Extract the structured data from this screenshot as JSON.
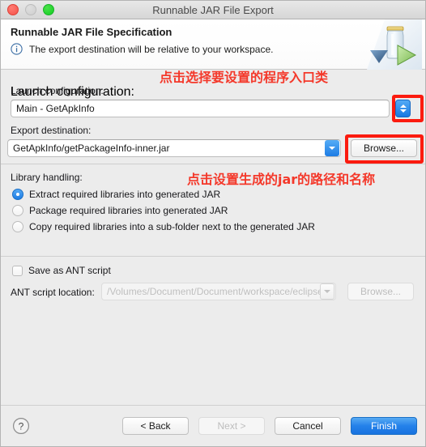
{
  "window": {
    "title": "Runnable JAR File Export",
    "traffic_lights": [
      "close-button",
      "minimize-button",
      "zoom-button"
    ]
  },
  "header": {
    "title": "Runnable JAR File Specification",
    "message": "The export destination will be relative to your workspace.",
    "info_icon": "info-icon",
    "banner_icon": "jar-export-icon"
  },
  "form": {
    "launch_configuration": {
      "label": "Launch configuration:",
      "value": "Main - GetApkInfo",
      "stepper_icon": "up-down-stepper-icon"
    },
    "export_destination": {
      "label": "Export destination:",
      "value": "GetApkInfo/getPackageInfo-inner.jar",
      "dropdown_icon": "chevron-down-icon",
      "browse_label": "Browse..."
    },
    "library_handling": {
      "label": "Library handling:",
      "options": [
        {
          "label": "Extract required libraries into generated JAR",
          "selected": true
        },
        {
          "label": "Package required libraries into generated JAR",
          "selected": false
        },
        {
          "label": "Copy required libraries into a sub-folder next to the generated JAR",
          "selected": false
        }
      ]
    },
    "ant": {
      "checkbox_label": "Save as ANT script",
      "checked": false,
      "location_label": "ANT script location:",
      "location_value": "/Volumes/Document/Document/workspace/eclipse/",
      "location_dropdown_icon": "chevron-down-icon",
      "browse_label": "Browse...",
      "disabled": true
    }
  },
  "annotations": [
    {
      "text": "点击选择要设置的程序入口类",
      "target": "launch-configuration-stepper"
    },
    {
      "text": "点击设置生成的jar的路径和名称",
      "target": "export-destination-browse"
    }
  ],
  "footer": {
    "help_icon": "help-question-icon",
    "back_label": "< Back",
    "next_label": "Next >",
    "cancel_label": "Cancel",
    "finish_label": "Finish"
  },
  "colors": {
    "accent_blue": "#1d7ce4",
    "annotation_red": "#fb1b0f",
    "window_bg": "#ececec"
  }
}
